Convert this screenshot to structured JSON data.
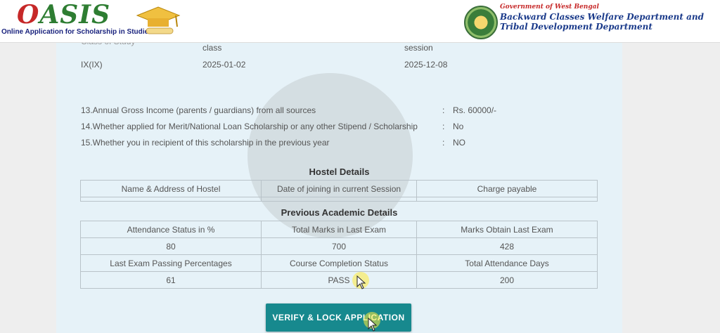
{
  "header": {
    "logo_text": "OASIS",
    "logo_tagline": "Online Application for Scholarship in Studies",
    "gov_label": "Government of West Bengal",
    "dept_line1": "Backward Classes Welfare Department and",
    "dept_line2": "Tribal Development Department"
  },
  "top_fields": {
    "cutoff_label": "Class of Study",
    "class_label": "class",
    "session_label": "session",
    "class_value": "IX(IX)",
    "class_date": "2025-01-02",
    "session_date": "2025-12-08"
  },
  "questions": [
    {
      "label": "13.Annual Gross Income (parents / guardians) from all sources",
      "sep": ":",
      "value": "Rs. 60000/-"
    },
    {
      "label": "14.Whether applied for Merit/National Loan Scholarship or any other Stipend / Scholarship",
      "sep": ":",
      "value": "No"
    },
    {
      "label": "15.Whether you in recipient of this scholarship in the previous year",
      "sep": ":",
      "value": "NO"
    }
  ],
  "hostel": {
    "title": "Hostel Details",
    "headers": [
      "Name & Address of Hostel",
      "Date of joining in current Session",
      "Charge payable"
    ]
  },
  "academic": {
    "title": "Previous Academic Details",
    "headers1": [
      "Attendance Status in %",
      "Total Marks in Last Exam",
      "Marks Obtain Last Exam"
    ],
    "row1": [
      "80",
      "700",
      "428"
    ],
    "headers2": [
      "Last Exam Passing Percentages",
      "Course Completion Status",
      "Total Attendance Days"
    ],
    "row2": [
      "61",
      "PASS",
      "200"
    ]
  },
  "actions": {
    "verify_label": "VERIFY & LOCK APPLICATION"
  }
}
